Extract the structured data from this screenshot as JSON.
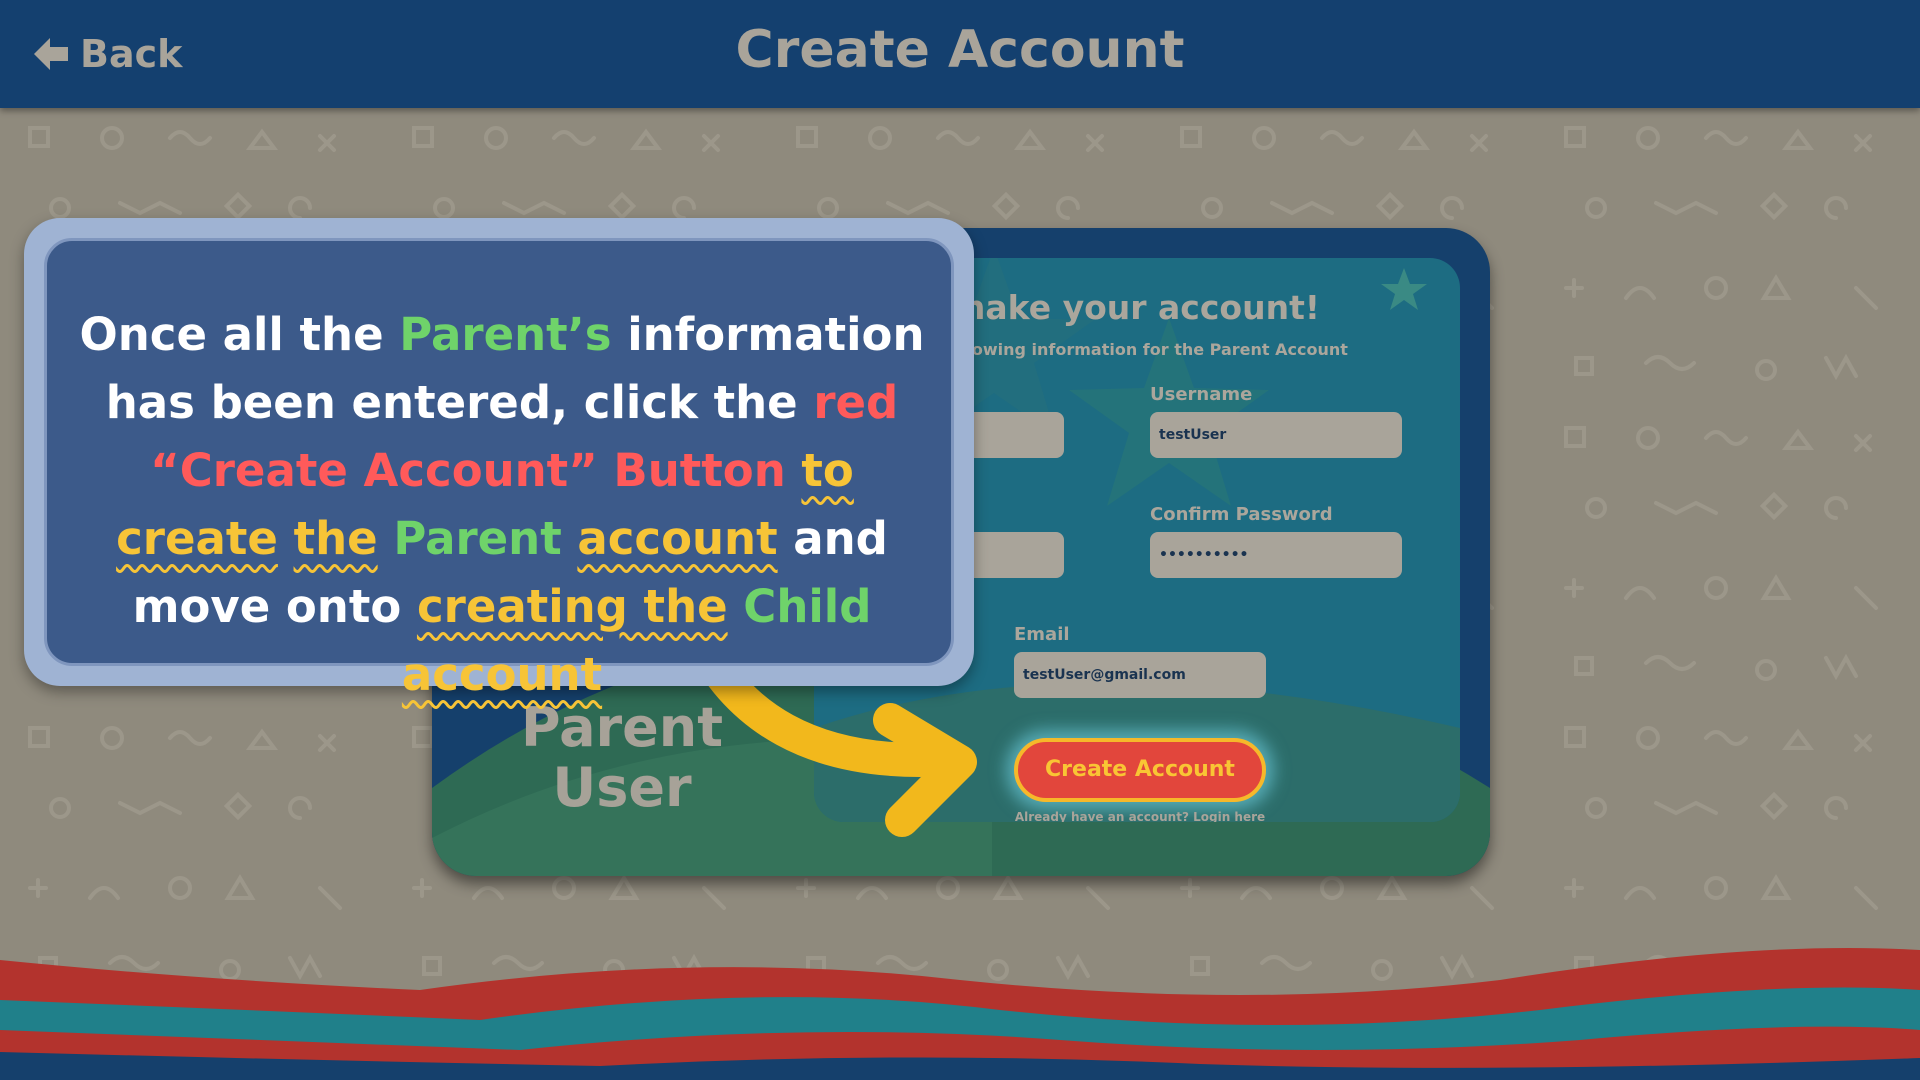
{
  "header": {
    "back_label": "Back",
    "title": "Create Account"
  },
  "card": {
    "side_label_line1": "Parent",
    "side_label_line2": "User",
    "heading_visible": "t's make your account!",
    "subheading_visible": "r the following information for the Parent Account",
    "fields": {
      "username_label": "Username",
      "username_value": "testUser",
      "confirm_password_label": "Confirm Password",
      "confirm_password_value": "••••••••••",
      "email_label": "Email",
      "email_value": "testUser@gmail.com"
    },
    "create_button_label": "Create Account",
    "login_link_label": "Already have an account? Login here"
  },
  "instruction": {
    "parts": [
      "Once all the",
      "Parent’s",
      "information has been entered, click the",
      "red “Create Account” Button",
      "to create",
      "the",
      "Parent",
      "account",
      "and move onto",
      "creating the",
      "Child",
      "account"
    ]
  },
  "colors": {
    "header_bg": "#14406f",
    "background": "#8f8a7d",
    "accent_red": "#e2463c",
    "accent_yellow": "#f7c437",
    "accent_green": "#6fd36a",
    "popup_bg": "#3c5a8a"
  },
  "icons": {
    "back": "arrow-left-icon",
    "pointer_arrow": "curved-arrow-icon"
  }
}
